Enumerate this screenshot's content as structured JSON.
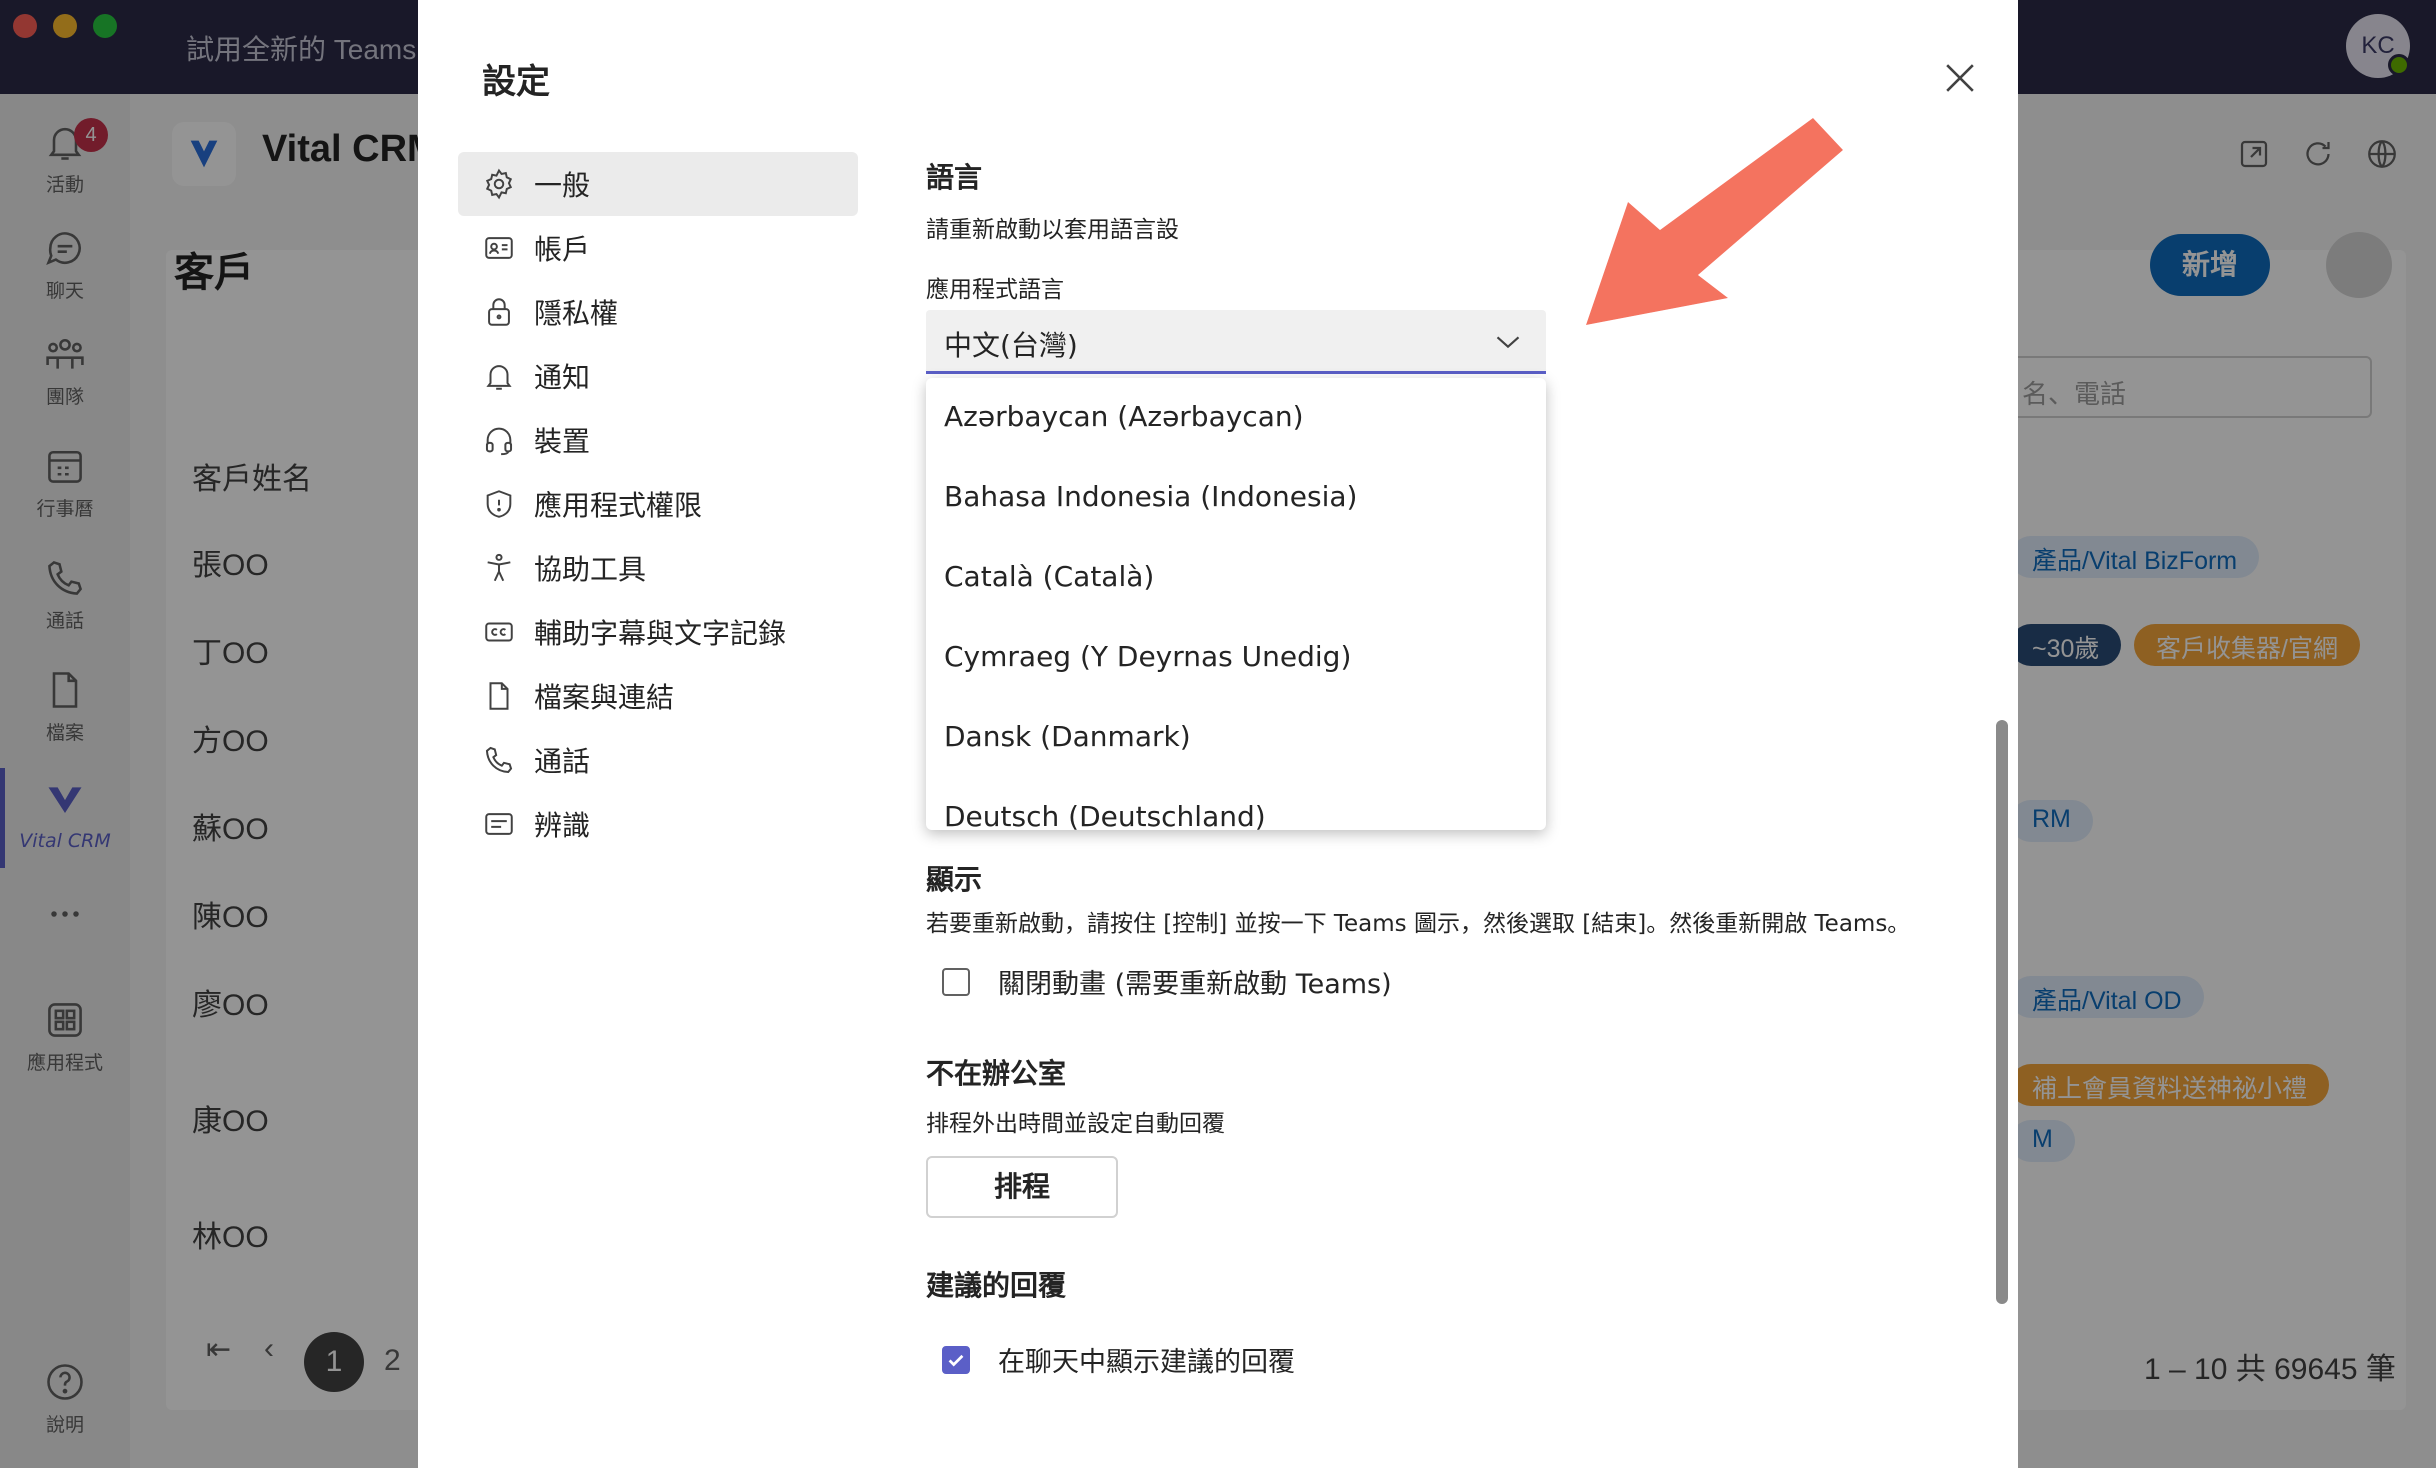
{
  "window": {
    "title": "試用全新的 Teams",
    "user_initials": "KC"
  },
  "rail": {
    "items": [
      {
        "label": "活動",
        "icon": "bell-icon"
      },
      {
        "label": "聊天",
        "icon": "chat-icon",
        "badge": "4"
      },
      {
        "label": "團隊",
        "icon": "teams-icon"
      },
      {
        "label": "行事曆",
        "icon": "calendar-icon"
      },
      {
        "label": "通話",
        "icon": "phone-icon"
      },
      {
        "label": "檔案",
        "icon": "file-icon"
      },
      {
        "label": "Vital CRM",
        "icon": "vital-crm-icon",
        "active": true
      },
      {
        "label": "",
        "icon": "more-icon"
      },
      {
        "label": "應用程式",
        "icon": "apps-icon"
      },
      {
        "label": "說明",
        "icon": "help-icon"
      }
    ]
  },
  "background_app": {
    "name": "Vital CRM",
    "page_title": "客戶",
    "new_button": "新增",
    "search_placeholder": "名、電話",
    "column_header": "客戶姓名",
    "rows": [
      "張OO",
      "丁OO",
      "方OO",
      "蘇OO",
      "陳OO",
      "廖OO",
      "康OO",
      "林OO",
      "林OO"
    ],
    "tags": [
      "產品/Vital BizForm",
      "~30歲",
      "客戶收集器/官網",
      "RM",
      "產品/Vital OD",
      "補上會員資料送神祕小禮",
      "M",
      "RM"
    ],
    "pager_current": "1",
    "pager_next": "2",
    "total": "1 – 10 共 69645 筆"
  },
  "dialog": {
    "title": "設定",
    "nav": [
      {
        "label": "一般",
        "icon": "gear-icon",
        "selected": true
      },
      {
        "label": "帳戶",
        "icon": "id-card-icon"
      },
      {
        "label": "隱私權",
        "icon": "lock-icon"
      },
      {
        "label": "通知",
        "icon": "bell-icon"
      },
      {
        "label": "裝置",
        "icon": "headset-icon"
      },
      {
        "label": "應用程式權限",
        "icon": "shield-icon"
      },
      {
        "label": "協助工具",
        "icon": "accessibility-icon"
      },
      {
        "label": "輔助字幕與文字記錄",
        "icon": "cc-icon"
      },
      {
        "label": "檔案與連結",
        "icon": "file-icon"
      },
      {
        "label": "通話",
        "icon": "phone-icon"
      },
      {
        "label": "辨識",
        "icon": "text-box-icon"
      }
    ],
    "language": {
      "heading": "語言",
      "hint": "請重新啟動以套用語言設",
      "app_language_label": "應用程式語言",
      "selected": "中文(台灣)",
      "options": [
        "Azərbaycan (Azərbaycan)",
        "Bahasa Indonesia (Indonesia)",
        "Català (Català)",
        "Cymraeg (Y Deyrnas Unedig)",
        "Dansk (Danmark)",
        "Deutsch (Deutschland)"
      ]
    },
    "display": {
      "heading": "顯示",
      "hint": "若要重新啟動，請按住 [控制] 並按一下 Teams 圖示，然後選取 [結束]。然後重新開啟 Teams。",
      "disable_animation_label": "關閉動畫 (需要重新啟動 Teams)",
      "disable_animation_checked": false
    },
    "out_of_office": {
      "heading": "不在辦公室",
      "hint": "排程外出時間並設定自動回覆",
      "schedule_button": "排程"
    },
    "suggested_replies": {
      "heading": "建議的回覆",
      "show_label": "在聊天中顯示建議的回覆",
      "show_checked": true
    }
  },
  "colors": {
    "accent": "#5b5fc7",
    "titlebar": "#2b2a47",
    "arrow": "#f4735f"
  }
}
